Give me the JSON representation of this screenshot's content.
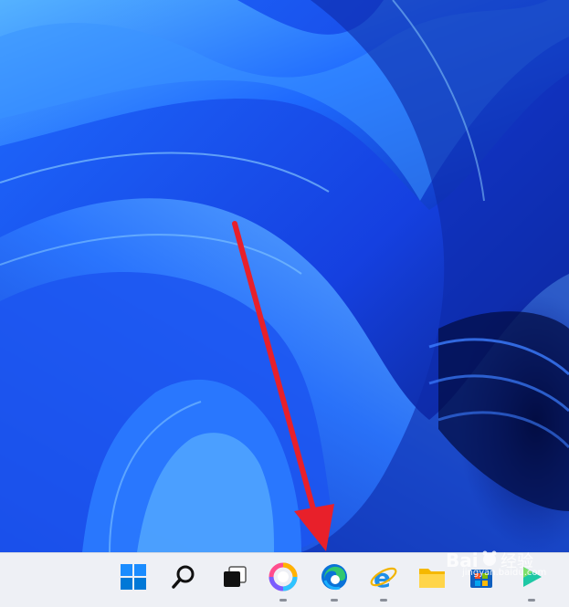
{
  "wallpaper": {
    "name": "Windows 11 Bloom",
    "colors": {
      "deep": "#0a1a7a",
      "mid": "#1e5bff",
      "light": "#4aa8ff",
      "highlight": "#8fd4ff"
    }
  },
  "annotation": {
    "arrow_color": "#e8202a",
    "points_to": "edge-taskbar-button"
  },
  "taskbar": {
    "background": "#eef0f5",
    "items": [
      {
        "id": "start",
        "icon": "windows-logo-icon"
      },
      {
        "id": "search",
        "icon": "search-icon"
      },
      {
        "id": "task-view",
        "icon": "task-view-icon"
      },
      {
        "id": "photos",
        "icon": "photos-icon",
        "running": true
      },
      {
        "id": "edge",
        "icon": "edge-icon",
        "running": true
      },
      {
        "id": "ie",
        "icon": "internet-explorer-icon",
        "running": true
      },
      {
        "id": "file-explorer",
        "icon": "folder-icon"
      },
      {
        "id": "store",
        "icon": "store-icon"
      },
      {
        "id": "media",
        "icon": "media-player-icon",
        "running": true
      }
    ]
  },
  "watermark": {
    "logo": "Bai 经验",
    "url": "jingyan.baidu.com"
  }
}
